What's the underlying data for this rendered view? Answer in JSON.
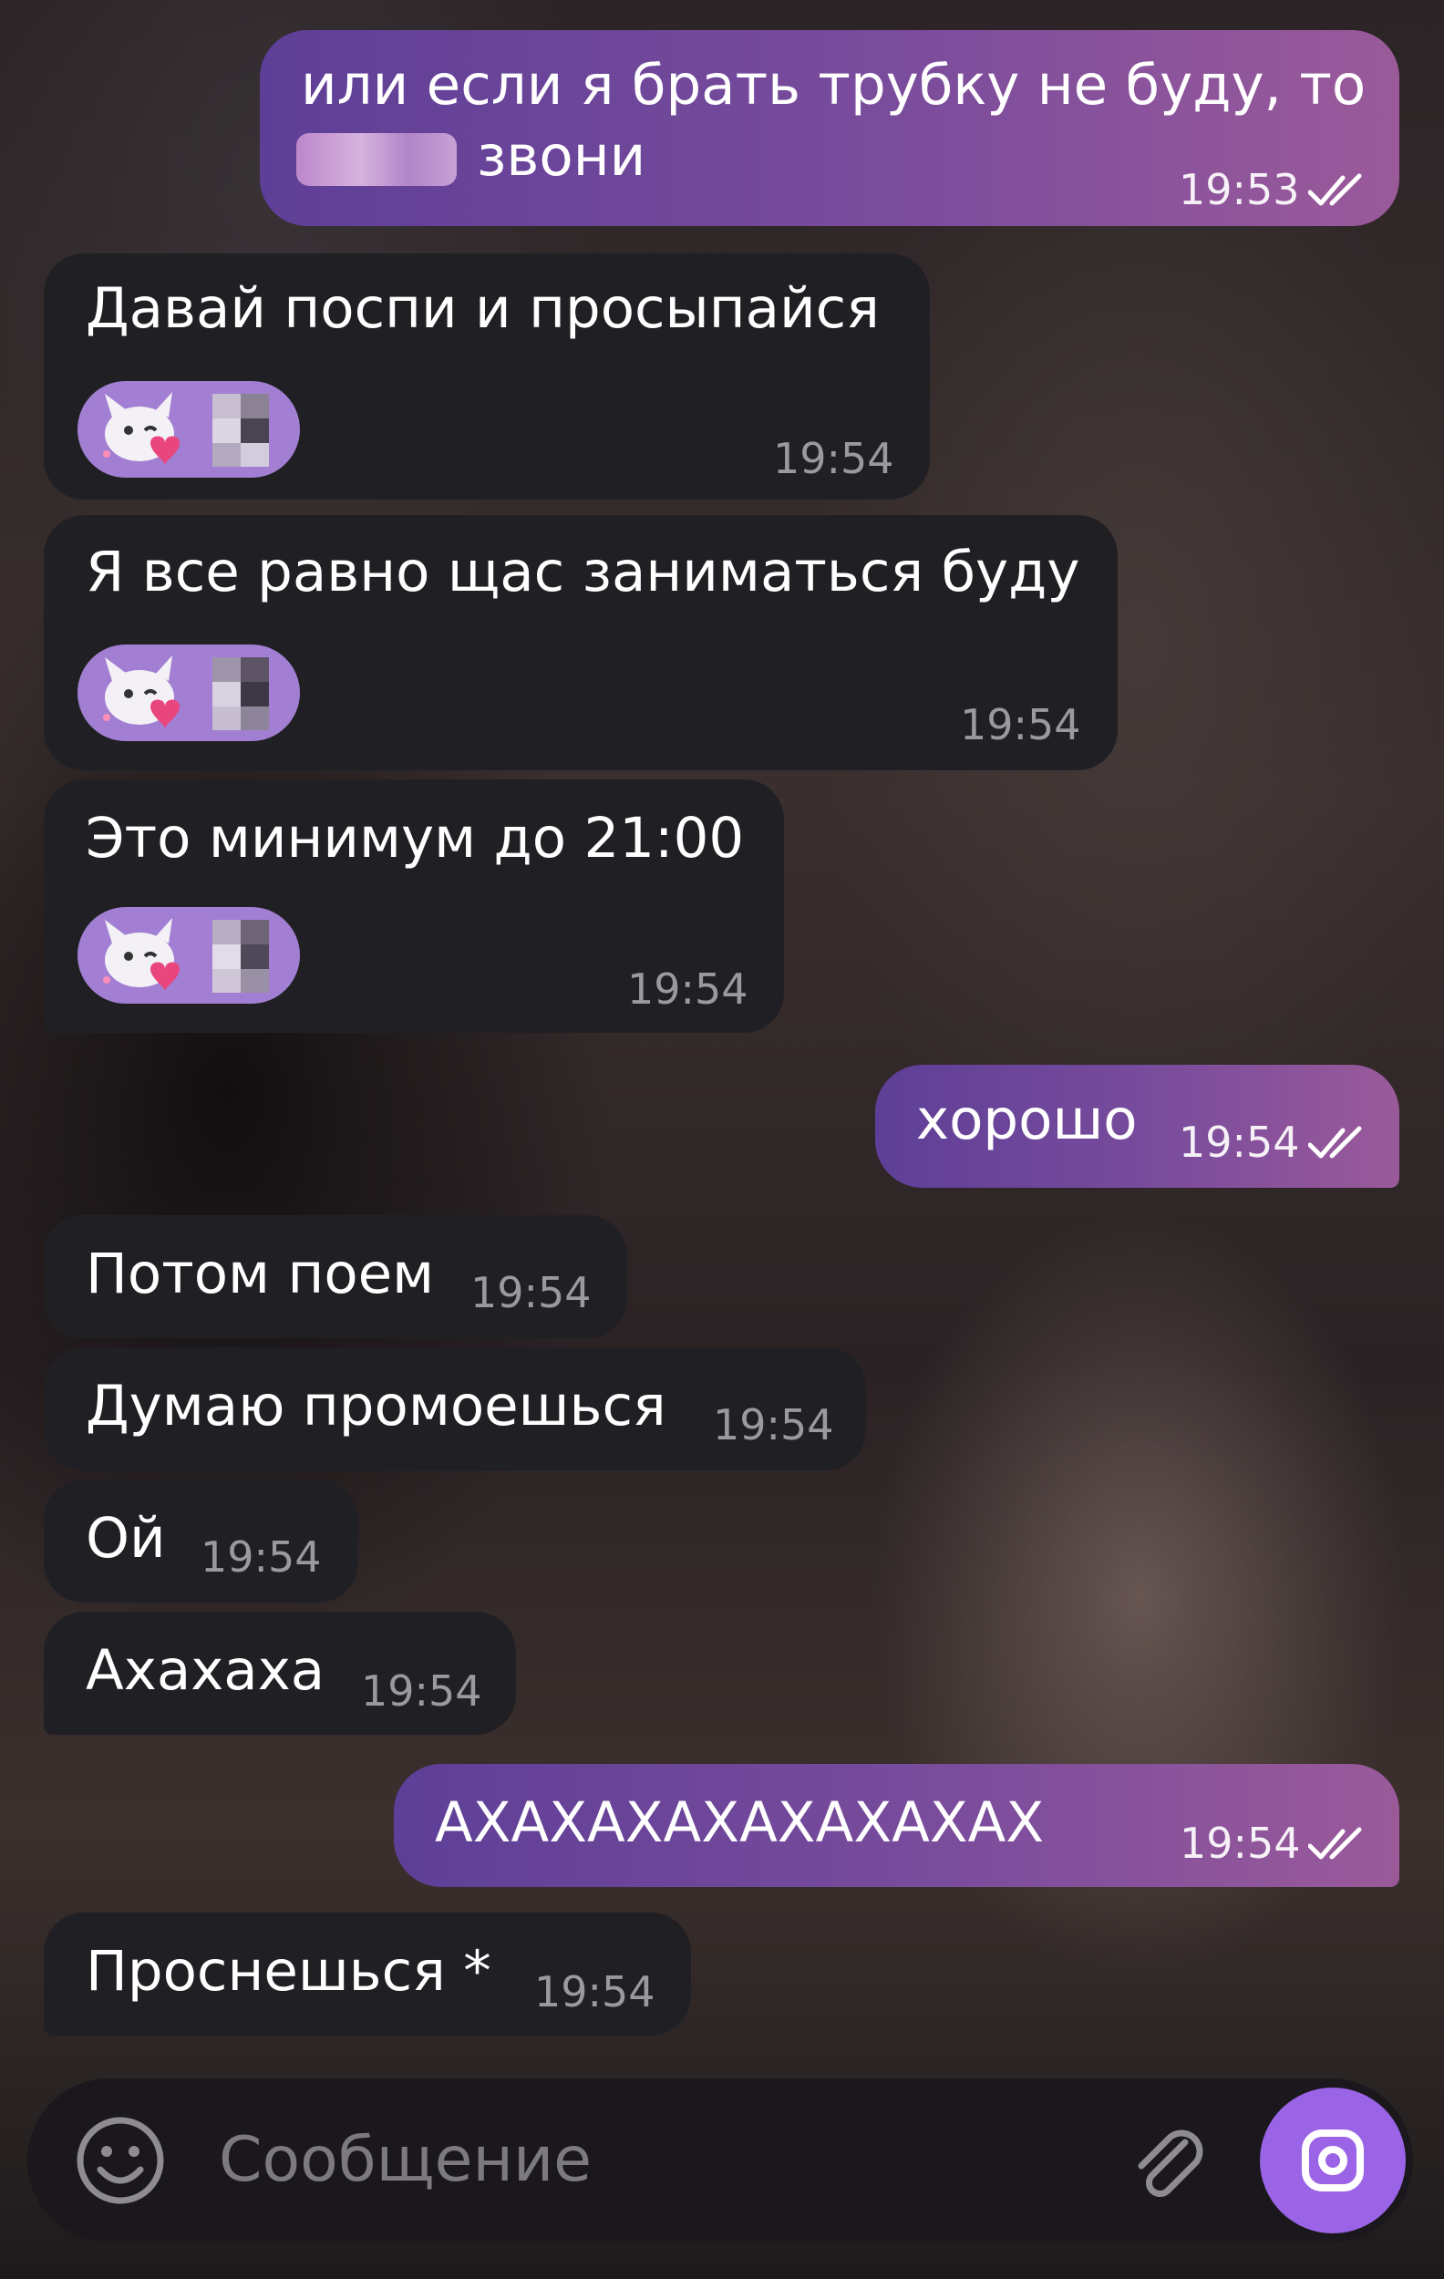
{
  "messages": [
    {
      "direction": "outgoing",
      "text_line1": "или если я брать трубку не буду, то",
      "text_line2": "звони",
      "time": "19:53",
      "status_icon": "double-check-icon"
    },
    {
      "direction": "incoming",
      "text": "Давай поспи и просыпайся",
      "time": "19:54",
      "stickers": [
        "cat-heart-emoji",
        "pixelated-emoji"
      ]
    },
    {
      "direction": "incoming",
      "text": "Я все равно щас заниматься буду",
      "time": "19:54",
      "stickers": [
        "cat-heart-emoji",
        "pixelated-emoji"
      ]
    },
    {
      "direction": "incoming",
      "text": "Это минимум до 21:00",
      "time": "19:54",
      "stickers": [
        "cat-heart-emoji",
        "pixelated-emoji"
      ]
    },
    {
      "direction": "outgoing",
      "text": "хорошо",
      "time": "19:54",
      "status_icon": "double-check-icon"
    },
    {
      "direction": "incoming",
      "text": "Потом поем",
      "time": "19:54"
    },
    {
      "direction": "incoming",
      "text": "Думаю промоешься",
      "time": "19:54"
    },
    {
      "direction": "incoming",
      "text": "Ой",
      "time": "19:54"
    },
    {
      "direction": "incoming",
      "text": "Ахахаха",
      "time": "19:54"
    },
    {
      "direction": "outgoing",
      "text": "АХАХАХАХАХАХАХАХ",
      "time": "19:54",
      "status_icon": "double-check-icon"
    },
    {
      "direction": "incoming",
      "text": "Проснешься *",
      "time": "19:54"
    }
  ],
  "composer": {
    "placeholder": "Сообщение",
    "emoji_icon": "smiley-icon",
    "attach_icon": "paperclip-icon",
    "camera_icon": "camera-icon"
  },
  "colors": {
    "outgoing_bubble": "#7a4c9c",
    "incoming_bubble": "#202024",
    "accent": "#9b63e6"
  }
}
